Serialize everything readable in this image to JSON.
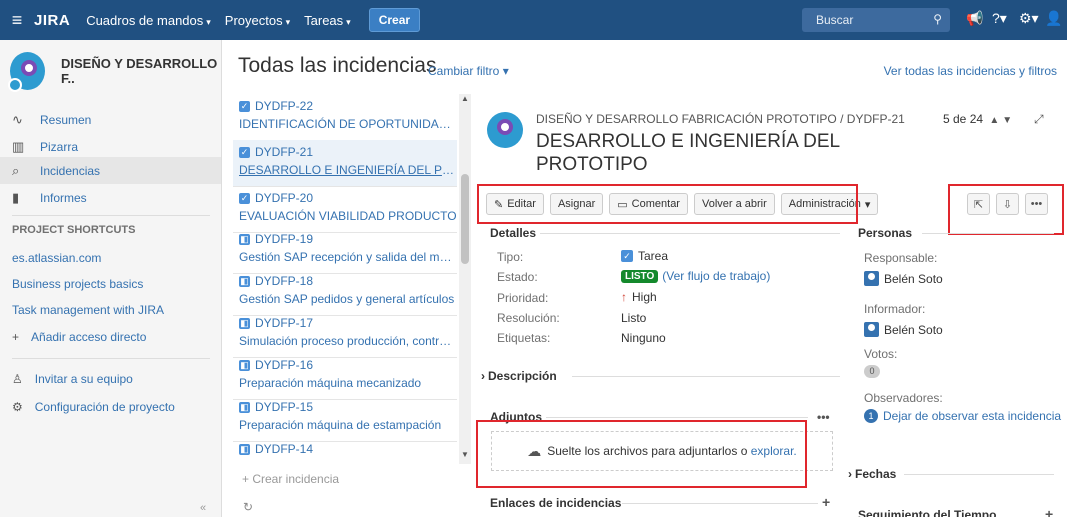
{
  "topbar": {
    "logo": "JIRA",
    "nav": [
      "Cuadros de mandos",
      "Proyectos",
      "Tareas"
    ],
    "create_label": "Crear",
    "search_placeholder": "Buscar"
  },
  "sidebar": {
    "project_name": "DISEÑO Y DESARROLLO F..",
    "items": [
      {
        "label": "Resumen",
        "icon": "pulse-icon"
      },
      {
        "label": "Pizarra",
        "icon": "board-icon"
      },
      {
        "label": "Incidencias",
        "icon": "issues-icon",
        "active": true
      },
      {
        "label": "Informes",
        "icon": "reports-icon"
      }
    ],
    "shortcuts_title": "PROJECT SHORTCUTS",
    "shortcuts": [
      "es.atlassian.com",
      "Business projects basics",
      "Task management with JIRA"
    ],
    "add_shortcut": "Añadir acceso directo",
    "invite": "Invitar a su equipo",
    "config": "Configuración de proyecto"
  },
  "header": {
    "title": "Todas las incidencias",
    "filter_link": "Cambiar filtro",
    "view_all": "Ver todas las incidencias y filtros"
  },
  "issues": [
    {
      "key": "DYDFP-22",
      "summary": "IDENTIFICACIÓN DE OPORTUNIDADES",
      "type": "task"
    },
    {
      "key": "DYDFP-21",
      "summary": "DESARROLLO E INGENIERÍA DEL PRO...",
      "type": "task",
      "selected": true
    },
    {
      "key": "DYDFP-20",
      "summary": "EVALUACIÓN VIABILIDAD PRODUCTO",
      "type": "task"
    },
    {
      "key": "DYDFP-19",
      "summary": "Gestión SAP recepción y salida del mate...",
      "type": "story"
    },
    {
      "key": "DYDFP-18",
      "summary": "Gestión SAP pedidos y general artículos",
      "type": "story"
    },
    {
      "key": "DYDFP-17",
      "summary": "Simulación proceso producción, control,...",
      "type": "story"
    },
    {
      "key": "DYDFP-16",
      "summary": "Preparación máquina mecanizado",
      "type": "story"
    },
    {
      "key": "DYDFP-15",
      "summary": "Preparación máquina de estampación",
      "type": "story"
    },
    {
      "key": "DYDFP-14",
      "summary": "",
      "type": "story"
    }
  ],
  "list_footer": {
    "create": "+ Crear incidencia"
  },
  "detail": {
    "project": "DISEÑO Y DESARROLLO FABRICACIÓN PROTOTIPO",
    "sep": "/",
    "key": "DYDFP-21",
    "title": "DESARROLLO E INGENIERÍA DEL PROTOTIPO",
    "pager": "5 de 24",
    "toolbar": {
      "edit": "Editar",
      "assign": "Asignar",
      "comment": "Comentar",
      "reopen": "Volver a abrir",
      "admin": "Administración"
    },
    "details_title": "Detalles",
    "fields": [
      {
        "label": "Tipo:",
        "value": "Tarea"
      },
      {
        "label": "Estado:",
        "value": "LISTO",
        "extra": "(Ver flujo de trabajo)"
      },
      {
        "label": "Prioridad:",
        "value": "High"
      },
      {
        "label": "Resolución:",
        "value": "Listo"
      },
      {
        "label": "Etiquetas:",
        "value": "Ninguno"
      }
    ],
    "description_title": "Descripción",
    "attachments_title": "Adjuntos",
    "drop_text": "Suelte los archivos para adjuntarlos o",
    "drop_link": "explorar.",
    "links_title": "Enlaces de incidencias"
  },
  "people": {
    "title": "Personas",
    "assignee_label": "Responsable:",
    "assignee": "Belén Soto",
    "reporter_label": "Informador:",
    "reporter": "Belén Soto",
    "votes_label": "Votos:",
    "votes": "0",
    "watchers_label": "Observadores:",
    "watchers_count": "1",
    "watch_link": "Dejar de observar esta incidencia",
    "dates_title": "Fechas",
    "tracking_title": "Seguimiento del Tiempo"
  },
  "colors": {
    "topbar": "#205081",
    "accent": "#3572b0",
    "highlight": "#e0262d",
    "done": "#14892c"
  }
}
